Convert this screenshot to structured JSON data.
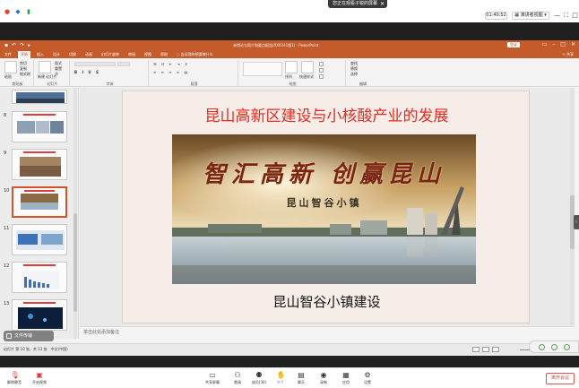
{
  "meeting": {
    "share_banner": "您正在观看子锐的屏幕",
    "share_close": "✕",
    "timer": "01:40:52",
    "view_button": "演讲者视图",
    "bottom_left": [
      {
        "label": "解除静音",
        "icon": "mic-off-icon"
      },
      {
        "label": "开启视频",
        "icon": "camera-off-icon"
      }
    ],
    "bottom_center": [
      {
        "label": "共享屏幕",
        "icon": "share-screen-icon"
      },
      {
        "label": "邀请",
        "icon": "invite-icon"
      },
      {
        "label": "成员(30)",
        "icon": "members-icon"
      },
      {
        "label": "举手",
        "icon": "hand-icon"
      },
      {
        "label": "聊天",
        "icon": "chat-icon"
      },
      {
        "label": "录制",
        "icon": "record-icon"
      },
      {
        "label": "应用",
        "icon": "apps-icon"
      },
      {
        "label": "设置",
        "icon": "settings-icon"
      }
    ],
    "leave": "离开会议"
  },
  "ppt": {
    "window_title": "未得论与简介和要点报告(XX0241版1) - PowerPoint",
    "login": "登录",
    "tabs": [
      "文件",
      "开始",
      "插入",
      "设计",
      "切换",
      "动画",
      "幻灯片放映",
      "审阅",
      "视图",
      "帮助",
      "告诉我你想要做什么"
    ],
    "active_tab": "开始",
    "share": "共享",
    "ribbon_groups": [
      "剪贴板",
      "幻灯片",
      "字体",
      "段落",
      "绘图",
      "编辑"
    ],
    "ribbon_items": {
      "paste": "粘贴",
      "cut": "剪切",
      "copy": "复制",
      "format_painter": "格式刷",
      "new_slide": "新建\n幻灯片",
      "layout": "版式",
      "reset": "重置",
      "section": "节",
      "arrange": "排列",
      "quick_styles": "快速样式",
      "find": "查找",
      "replace": "替换",
      "select": "选择"
    },
    "thumb_numbers": [
      "8",
      "9",
      "10",
      "11",
      "12",
      "13"
    ],
    "selected_thumb": 2,
    "slide": {
      "title": "昆山高新区建设与小核酸产业的发展",
      "image_calligraphy": "智汇高新 创赢昆山",
      "image_subtitle": "昆山智谷小镇",
      "caption": "昆山智谷小镇建设"
    },
    "notes_placeholder": "单击此处添加备注",
    "status_left": "幻灯片 第 10 张，共 13 张　中文(中国)",
    "zoom": "142%"
  },
  "float_tag": "文件传输",
  "colors": {
    "ppt_accent": "#c55a2b",
    "slide_title": "#e52b1f",
    "leave_red": "#e04040"
  }
}
